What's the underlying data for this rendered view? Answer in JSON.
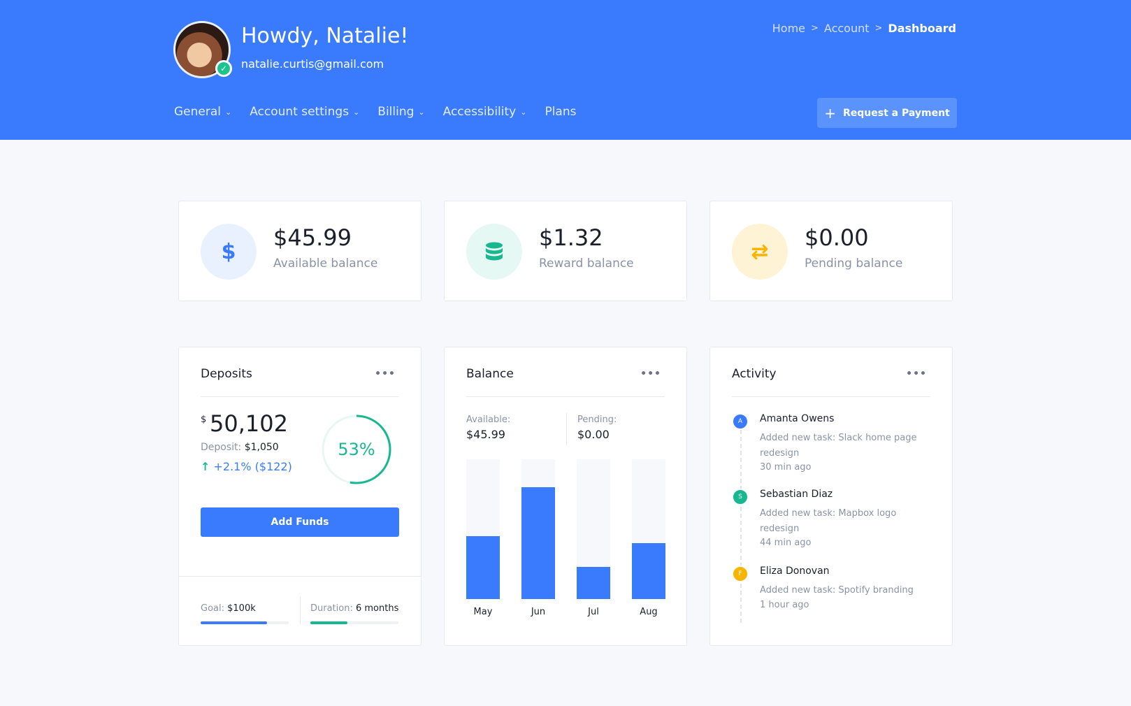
{
  "header": {
    "greeting": "Howdy, Natalie!",
    "email": "natalie.curtis@gmail.com",
    "breadcrumb": [
      "Home",
      "Account",
      "Dashboard"
    ],
    "nav": [
      {
        "label": "General",
        "has_dropdown": true
      },
      {
        "label": "Account settings",
        "has_dropdown": true
      },
      {
        "label": "Billing",
        "has_dropdown": true
      },
      {
        "label": "Accessibility",
        "has_dropdown": true
      },
      {
        "label": "Plans",
        "has_dropdown": false
      }
    ],
    "request_button": "Request a Payment"
  },
  "stats": [
    {
      "value": "$45.99",
      "label": "Available balance",
      "icon": "dollar-icon",
      "icon_glyph": "$",
      "icon_bg": "#e9f0fe",
      "icon_color": "#3a7bfd"
    },
    {
      "value": "$1.32",
      "label": "Reward balance",
      "icon": "database-icon",
      "icon_glyph": "",
      "icon_bg": "#e5f8f3",
      "icon_color": "#17b890"
    },
    {
      "value": "$0.00",
      "label": "Pending balance",
      "icon": "transfer-icon",
      "icon_glyph": "⇄",
      "icon_bg": "#fff3d6",
      "icon_color": "#f7b500"
    }
  ],
  "deposits": {
    "title": "Deposits",
    "currency": "$",
    "total": "50,102",
    "deposit_label": "Deposit:",
    "deposit_value": "$1,050",
    "change": "+2.1% ($122)",
    "ring_percent": 53,
    "ring_label": "53%",
    "button": "Add Funds",
    "goal_label": "Goal:",
    "goal_value": "$100k",
    "goal_progress": 0.75,
    "duration_label": "Duration:",
    "duration_value": "6 months",
    "duration_progress": 0.42
  },
  "balance": {
    "title": "Balance",
    "available_label": "Available:",
    "available_value": "$45.99",
    "pending_label": "Pending:",
    "pending_value": "$0.00",
    "chart_data": {
      "type": "bar",
      "categories": [
        "May",
        "Jun",
        "Jul",
        "Aug"
      ],
      "values": [
        0.45,
        0.8,
        0.23,
        0.4
      ],
      "ylim": [
        0,
        1
      ]
    }
  },
  "activity": {
    "title": "Activity",
    "items": [
      {
        "initial": "A",
        "color": "#3a7bfd",
        "name": "Amanta Owens",
        "desc": "Added new task: Slack home page redesign",
        "time": "30 min ago"
      },
      {
        "initial": "S",
        "color": "#17b890",
        "name": "Sebastian Diaz",
        "desc": "Added new task: Mapbox logo redesign",
        "time": "44 min ago"
      },
      {
        "initial": "F",
        "color": "#f7b500",
        "name": "Eliza Donovan",
        "desc": "Added new task: Spotify branding",
        "time": "1 hour ago"
      }
    ]
  },
  "colors": {
    "primary": "#3a7bfd",
    "success": "#17b890",
    "warning": "#f7b500"
  }
}
